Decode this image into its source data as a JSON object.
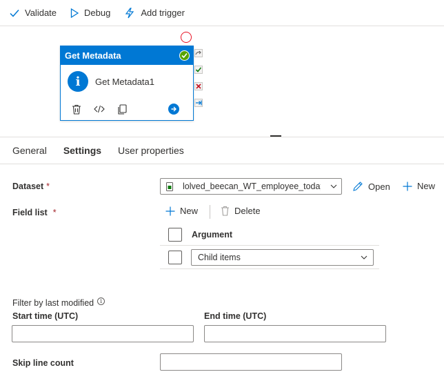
{
  "toolbar": {
    "validate_label": "Validate",
    "debug_label": "Debug",
    "add_trigger_label": "Add trigger"
  },
  "activity": {
    "header_title": "Get Metadata",
    "name": "Get Metadata1",
    "info_glyph": "i"
  },
  "tabs": [
    {
      "label": "General"
    },
    {
      "label": "Settings"
    },
    {
      "label": "User properties"
    }
  ],
  "settings": {
    "dataset": {
      "label": "Dataset",
      "required_mark": "*",
      "value": "lolved_beecan_WT_employee_today",
      "open_label": "Open",
      "new_label": "New"
    },
    "field_list": {
      "label": "Field list",
      "required_mark": "*",
      "new_label": "New",
      "delete_label": "Delete",
      "column_header": "Argument",
      "rows": [
        {
          "value": "Child items"
        }
      ]
    },
    "filter_label": "Filter by last modified",
    "info_glyph": "i",
    "start_time_label": "Start time (UTC)",
    "end_time_label": "End time (UTC)",
    "skip_line_label": "Skip line count"
  },
  "colors": {
    "accent": "#0078d4",
    "success": "#57a300",
    "failure": "#e81123"
  }
}
